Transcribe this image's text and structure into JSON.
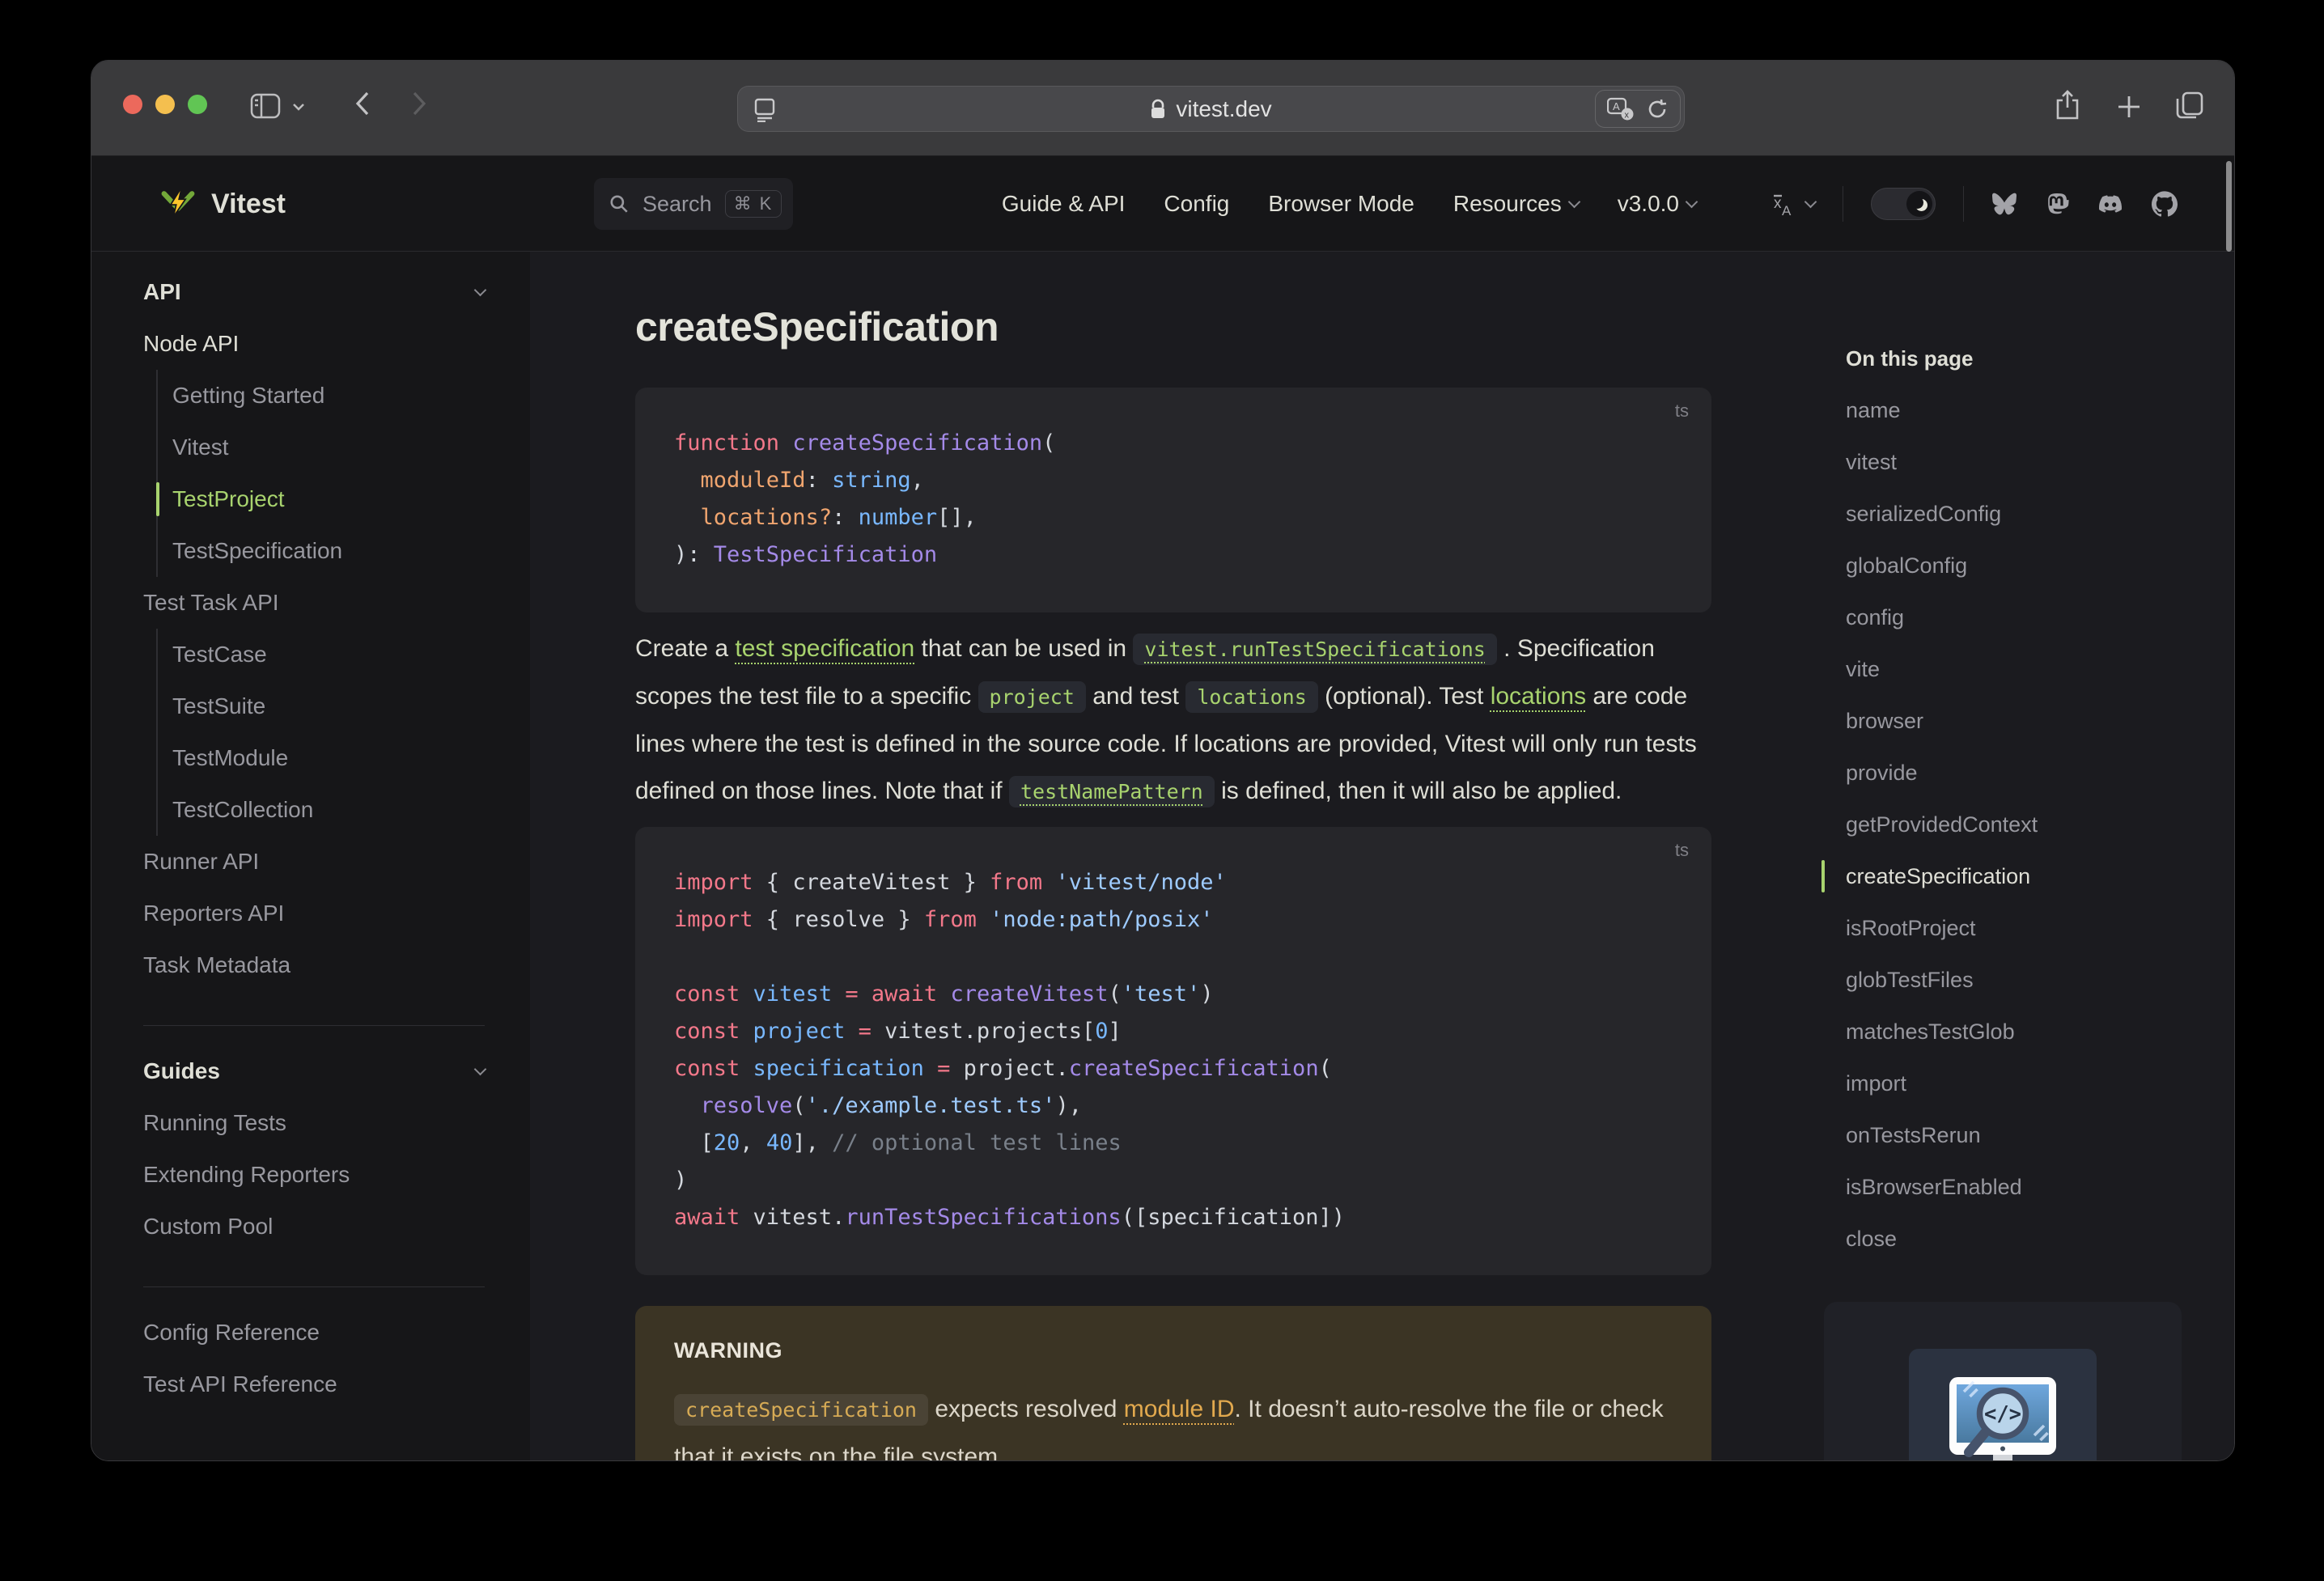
{
  "colors": {
    "brand": "#a8d36e",
    "page_bg": "#1b1b1f",
    "sidebar_bg": "#161618",
    "code_bg": "#26262a",
    "warning_bg": "#3b3424",
    "traffic_red": "#ec695c",
    "traffic_yellow": "#f4bf4f",
    "traffic_green": "#61c554"
  },
  "browser": {
    "url": "vitest.dev",
    "controls": [
      "close",
      "minimize",
      "zoom"
    ],
    "toolbar_icons": [
      "sidebar-toggle",
      "chevron-down",
      "back",
      "forward",
      "page-format",
      "lock",
      "translate",
      "reload",
      "share",
      "new-tab",
      "tab-overview"
    ]
  },
  "nav": {
    "logo": {
      "label": "Vitest"
    },
    "search": {
      "label": "Search",
      "kbd": "⌘ K"
    },
    "links": [
      {
        "label": "Guide & API"
      },
      {
        "label": "Config"
      },
      {
        "label": "Browser Mode"
      },
      {
        "label": "Resources",
        "chevron": true
      },
      {
        "label": "v3.0.0",
        "chevron": true
      }
    ],
    "controls": [
      "language",
      "theme-toggle",
      "bluesky",
      "mastodon",
      "discord",
      "github"
    ]
  },
  "sidebar": {
    "blocks": [
      {
        "type": "header",
        "label": "API",
        "chevron": true
      },
      {
        "type": "item",
        "label": "Node API",
        "tone": "strong"
      },
      {
        "type": "group",
        "items": [
          {
            "label": "Getting Started"
          },
          {
            "label": "Vitest"
          },
          {
            "label": "TestProject",
            "active": true
          },
          {
            "label": "TestSpecification"
          }
        ]
      },
      {
        "type": "item",
        "label": "Test Task API"
      },
      {
        "type": "group",
        "items": [
          {
            "label": "TestCase"
          },
          {
            "label": "TestSuite"
          },
          {
            "label": "TestModule"
          },
          {
            "label": "TestCollection"
          }
        ]
      },
      {
        "type": "item",
        "label": "Runner API"
      },
      {
        "type": "item",
        "label": "Reporters API"
      },
      {
        "type": "item",
        "label": "Task Metadata"
      },
      {
        "type": "divider"
      },
      {
        "type": "header",
        "label": "Guides",
        "chevron": true
      },
      {
        "type": "item",
        "label": "Running Tests"
      },
      {
        "type": "item",
        "label": "Extending Reporters"
      },
      {
        "type": "item",
        "label": "Custom Pool"
      },
      {
        "type": "divider"
      },
      {
        "type": "item",
        "label": "Config Reference"
      },
      {
        "type": "item",
        "label": "Test API Reference"
      }
    ]
  },
  "main": {
    "heading": "createSpecification",
    "code_blocks": [
      {
        "lang": "ts",
        "lines": [
          [
            [
              "kw",
              "function"
            ],
            [
              "pl",
              " "
            ],
            [
              "fn",
              "createSpecification"
            ],
            [
              "pl",
              "("
            ]
          ],
          [
            [
              "pl",
              "  "
            ],
            [
              "par",
              "moduleId"
            ],
            [
              "pl",
              ": "
            ],
            [
              "typ",
              "string"
            ],
            [
              "pl",
              ","
            ]
          ],
          [
            [
              "pl",
              "  "
            ],
            [
              "par",
              "locations?"
            ],
            [
              "pl",
              ": "
            ],
            [
              "typ",
              "number"
            ],
            [
              "pl",
              "[],"
            ]
          ],
          [
            [
              "pl",
              "): "
            ],
            [
              "fn",
              "TestSpecification"
            ]
          ]
        ]
      },
      {
        "lang": "ts",
        "lines": [
          [
            [
              "kw",
              "import"
            ],
            [
              "pl",
              " { createVitest } "
            ],
            [
              "kw",
              "from"
            ],
            [
              "pl",
              " "
            ],
            [
              "str",
              "'vitest/node'"
            ]
          ],
          [
            [
              "kw",
              "import"
            ],
            [
              "pl",
              " { resolve } "
            ],
            [
              "kw",
              "from"
            ],
            [
              "pl",
              " "
            ],
            [
              "str",
              "'node:path/posix'"
            ]
          ],
          [],
          [
            [
              "kw",
              "const"
            ],
            [
              "pl",
              " "
            ],
            [
              "var",
              "vitest"
            ],
            [
              "pl",
              " "
            ],
            [
              "kw",
              "="
            ],
            [
              "pl",
              " "
            ],
            [
              "kw",
              "await"
            ],
            [
              "pl",
              " "
            ],
            [
              "fn",
              "createVitest"
            ],
            [
              "pl",
              "("
            ],
            [
              "str",
              "'test'"
            ],
            [
              "pl",
              ")"
            ]
          ],
          [
            [
              "kw",
              "const"
            ],
            [
              "pl",
              " "
            ],
            [
              "var",
              "project"
            ],
            [
              "pl",
              " "
            ],
            [
              "kw",
              "="
            ],
            [
              "pl",
              " vitest.projects["
            ],
            [
              "num",
              "0"
            ],
            [
              "pl",
              "]"
            ]
          ],
          [
            [
              "kw",
              "const"
            ],
            [
              "pl",
              " "
            ],
            [
              "var",
              "specification"
            ],
            [
              "pl",
              " "
            ],
            [
              "kw",
              "="
            ],
            [
              "pl",
              " project."
            ],
            [
              "fn",
              "createSpecification"
            ],
            [
              "pl",
              "("
            ]
          ],
          [
            [
              "pl",
              "  "
            ],
            [
              "fn",
              "resolve"
            ],
            [
              "pl",
              "("
            ],
            [
              "str",
              "'./example.test.ts'"
            ],
            [
              "pl",
              "),"
            ]
          ],
          [
            [
              "pl",
              "  ["
            ],
            [
              "num",
              "20"
            ],
            [
              "pl",
              ", "
            ],
            [
              "num",
              "40"
            ],
            [
              "pl",
              "], "
            ],
            [
              "com",
              "// optional test lines"
            ]
          ],
          [
            [
              "pl",
              ")"
            ]
          ],
          [
            [
              "kw",
              "await"
            ],
            [
              "pl",
              " vitest."
            ],
            [
              "fn",
              "runTestSpecifications"
            ],
            [
              "pl",
              "([specification])"
            ]
          ]
        ]
      }
    ],
    "paragraph": [
      {
        "k": "text",
        "t": "Create a "
      },
      {
        "k": "link",
        "t": "test specification"
      },
      {
        "k": "text",
        "t": " that can be used in "
      },
      {
        "k": "codelink",
        "t": "vitest.runTestSpecifications"
      },
      {
        "k": "text",
        "t": " . Specification scopes the test file to a specific "
      },
      {
        "k": "code",
        "t": "project"
      },
      {
        "k": "text",
        "t": " and test "
      },
      {
        "k": "code",
        "t": "locations"
      },
      {
        "k": "text",
        "t": " (optional). Test "
      },
      {
        "k": "link",
        "t": "locations"
      },
      {
        "k": "text",
        "t": " are code lines where the test is defined in the source code. If locations are provided, Vitest will only run tests defined on those lines. Note that if "
      },
      {
        "k": "codelink",
        "t": "testNamePattern"
      },
      {
        "k": "text",
        "t": " is defined, then it will also be applied."
      }
    ],
    "warning": {
      "title": "WARNING",
      "body": [
        {
          "k": "code",
          "t": "createSpecification"
        },
        {
          "k": "text",
          "t": " expects resolved "
        },
        {
          "k": "link",
          "t": "module ID"
        },
        {
          "k": "text",
          "t": ". It doesn’t auto-resolve the file or check that it exists on the file system."
        }
      ]
    }
  },
  "aside": {
    "title": "On this page",
    "items": [
      {
        "label": "name"
      },
      {
        "label": "vitest"
      },
      {
        "label": "serializedConfig"
      },
      {
        "label": "globalConfig"
      },
      {
        "label": "config"
      },
      {
        "label": "vite"
      },
      {
        "label": "browser"
      },
      {
        "label": "provide"
      },
      {
        "label": "getProvidedContext"
      },
      {
        "label": "createSpecification",
        "active": true
      },
      {
        "label": "isRootProject"
      },
      {
        "label": "globTestFiles"
      },
      {
        "label": "matchesTestGlob"
      },
      {
        "label": "import"
      },
      {
        "label": "onTestsRerun"
      },
      {
        "label": "isBrowserEnabled"
      },
      {
        "label": "close"
      }
    ],
    "card": {
      "icon": "code-search-monitor-illustration"
    }
  }
}
